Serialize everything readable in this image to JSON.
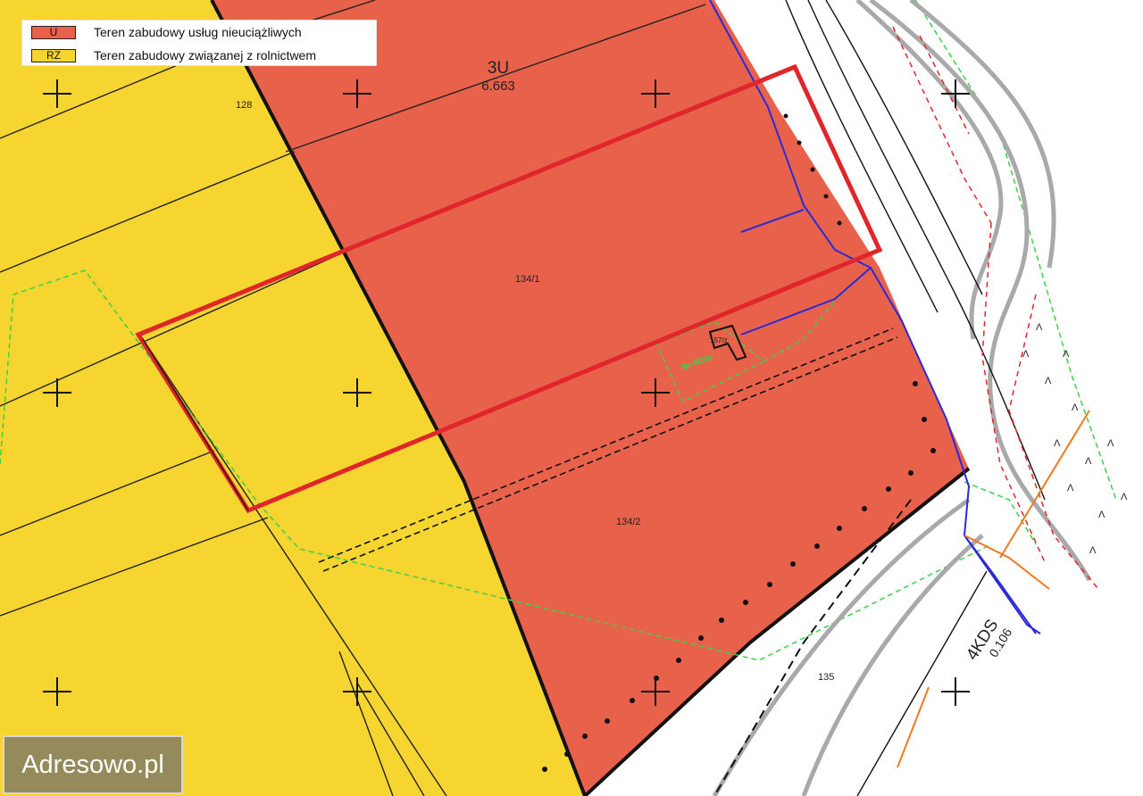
{
  "legend": {
    "items": [
      {
        "code": "U",
        "label": "Teren zabudowy usług nieuciążliwych",
        "color": "#E8614A"
      },
      {
        "code": "RZ",
        "label": "Teren zabudowy związanej z rolnictwem",
        "color": "#F7D531"
      }
    ]
  },
  "zones": {
    "service_zone": {
      "id": "3U",
      "area": "6.663"
    },
    "road_zone": {
      "id": "4KDS",
      "area": "0.106"
    }
  },
  "parcels": {
    "p128": "128",
    "p134_1": "134/1",
    "p134_2": "134/2",
    "p135": "135",
    "p157": "157/z"
  },
  "annotations": {
    "building_label": "Br-RlVa"
  },
  "watermark": "Adresowo.pl",
  "colors": {
    "agri": "#F7D531",
    "service": "#E8614A",
    "plot_outline": "#E0262B",
    "water_line": "#2A2AD8",
    "boundary_green": "#3BD14A",
    "gas_line": "#F07A1F",
    "road": "#A9A9A9"
  }
}
